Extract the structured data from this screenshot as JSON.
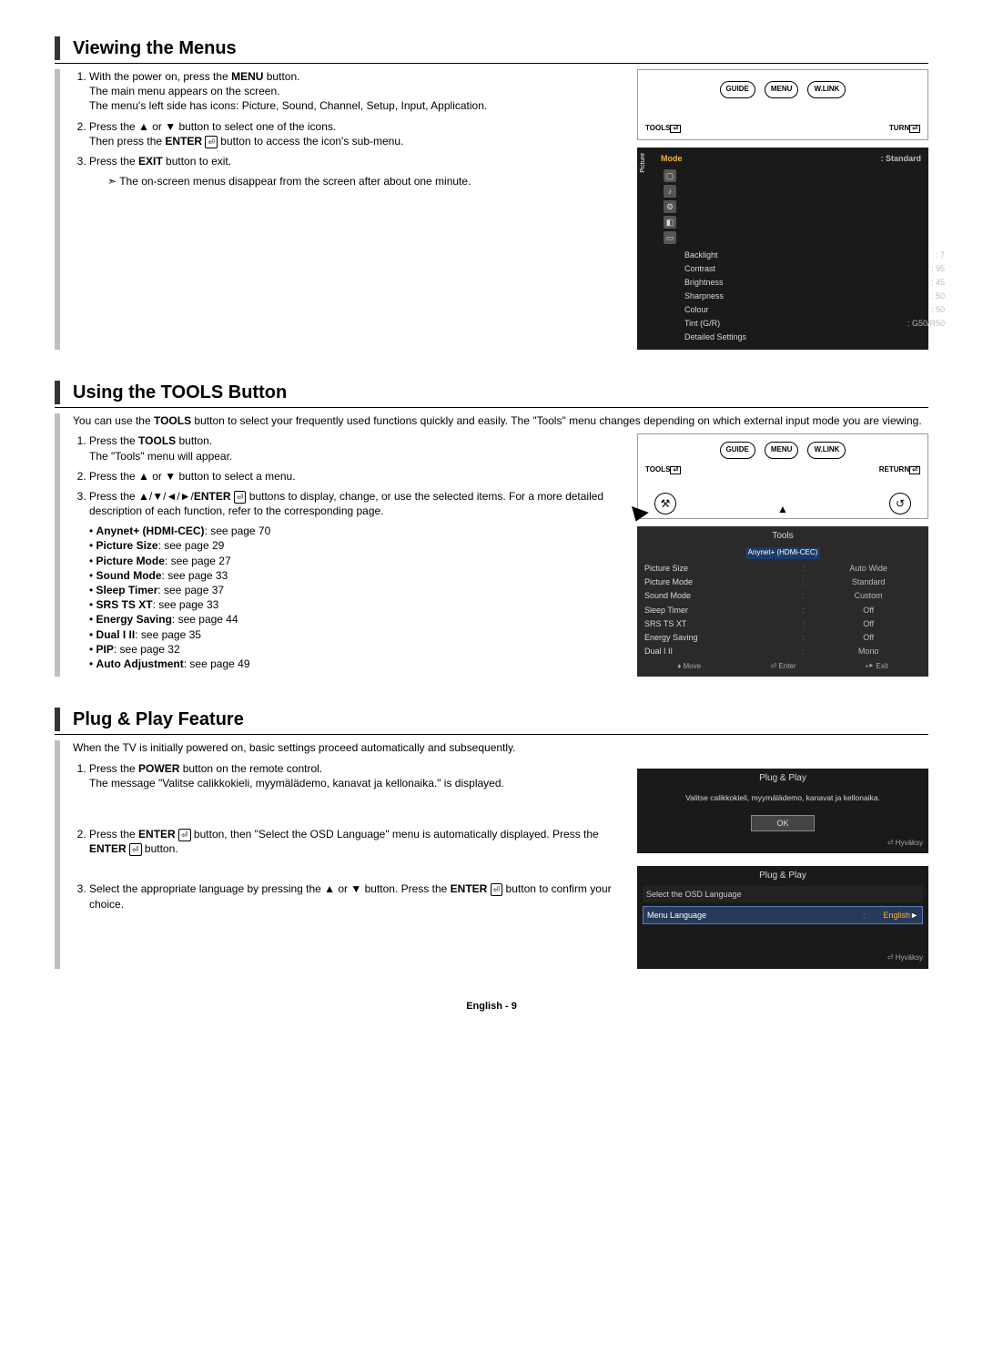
{
  "sections": {
    "viewing": {
      "title": "Viewing the Menus",
      "step1a": "With the power on, press the ",
      "step1b": "MENU",
      "step1c": " button.",
      "step1d": "The main menu appears on the screen.",
      "step1e": "The menu's left side has icons: Picture, Sound, Channel, Setup, Input, Application.",
      "step2a": "Press the ▲ or ▼ button to select one of the icons.",
      "step2b": "Then press the ",
      "step2c": "ENTER",
      "step2d": " button to access the icon's sub-menu.",
      "step3a": "Press the ",
      "step3b": "EXIT",
      "step3c": " button to exit.",
      "note": "The on-screen menus disappear from the screen after about one minute."
    },
    "tools": {
      "title": "Using the TOOLS Button",
      "intro1": "You can use the ",
      "intro2": "TOOLS",
      "intro3": " button to select your frequently used functions quickly and easily. The \"Tools\" menu changes depending on which external input mode you are viewing.",
      "step1a": "Press the ",
      "step1b": "TOOLS",
      "step1c": " button.",
      "step1d": "The \"Tools\" menu will appear.",
      "step2": "Press the ▲ or ▼ button to select a menu.",
      "step3a": "Press the ▲/▼/◄/►/",
      "step3b": "ENTER",
      "step3c": " buttons to display, change, or use the selected items. For a more detailed description of each function, refer to the corresponding page.",
      "list": [
        {
          "b": "Anynet+ (HDMI-CEC)",
          "t": ": see page 70"
        },
        {
          "b": "Picture Size",
          "t": ": see page 29"
        },
        {
          "b": "Picture Mode",
          "t": ": see page 27"
        },
        {
          "b": "Sound Mode",
          "t": ": see page 33"
        },
        {
          "b": "Sleep Timer",
          "t": ": see page 37"
        },
        {
          "b": "SRS TS XT",
          "t": ": see page 33"
        },
        {
          "b": "Energy Saving",
          "t": ": see page 44"
        },
        {
          "b": "Dual I II",
          "t": ": see page 35"
        },
        {
          "b": "PIP",
          "t": ": see page 32"
        },
        {
          "b": "Auto Adjustment",
          "t": ": see page 49"
        }
      ]
    },
    "plug": {
      "title": "Plug & Play Feature",
      "intro": "When the TV is initially powered on, basic settings proceed automatically and subsequently.",
      "step1a": "Press the ",
      "step1b": "POWER",
      "step1c": " button on the remote control.",
      "step1d": "The message \"Valitse calikkokieli, myymälädemo, kanavat ja kellonaika.\" is displayed.",
      "step2a": "Press the ",
      "step2b": "ENTER",
      "step2c": " button, then \"Select the OSD Language\" menu is automatically displayed. Press the ",
      "step2d": "ENTER",
      "step2e": " button.",
      "step3a": "Select the appropriate language by pressing the ▲ or ▼ button. Press the ",
      "step3b": "ENTER",
      "step3c": " button to confirm your choice."
    }
  },
  "remote": {
    "guide": "GUIDE",
    "menu": "MENU",
    "wlink": "W.LINK",
    "tools": "TOOLS",
    "return": "RETURN",
    "turn": "TURN"
  },
  "osd_picture": {
    "tab": "Picture",
    "mode_label": "Mode",
    "mode_value": "Standard",
    "rows": [
      {
        "k": "Backlight",
        "v": ": 7"
      },
      {
        "k": "Contrast",
        "v": ": 95"
      },
      {
        "k": "Brightness",
        "v": ": 45"
      },
      {
        "k": "Sharpness",
        "v": ": 50"
      },
      {
        "k": "Colour",
        "v": ": 50"
      },
      {
        "k": "Tint (G/R)",
        "v": ": G50/R50"
      },
      {
        "k": "Detailed Settings",
        "v": ""
      }
    ]
  },
  "osd_tools": {
    "title": "Tools",
    "hi": "Anynet+ (HDMi-CEC)",
    "rows": [
      {
        "k": "Picture Size",
        "v": "Auto Wide"
      },
      {
        "k": "Picture Mode",
        "v": "Standard"
      },
      {
        "k": "Sound Mode",
        "v": "Custom"
      },
      {
        "k": "Sleep Timer",
        "v": "Off"
      },
      {
        "k": "SRS TS XT",
        "v": "Off"
      },
      {
        "k": "Energy Saving",
        "v": "Off"
      },
      {
        "k": "Dual I II",
        "v": "Mono"
      }
    ],
    "footer": {
      "move": "♦ Move",
      "enter": "⏎ Enter",
      "exit": "▪⯈ Exit"
    }
  },
  "osd_plug1": {
    "title": "Plug & Play",
    "msg": "Valitse calikkokieli, myymälädemo, kanavat ja kellonaika.",
    "ok": "OK",
    "hyv": "⏎ Hyväksy"
  },
  "osd_plug2": {
    "title": "Plug & Play",
    "head": "Select the OSD Language",
    "k": "Menu Language",
    "v": "English",
    "hyv": "⏎ Hyväksy"
  },
  "enter_glyph": "⏎",
  "note_arrow": "➣",
  "footer": "English - 9"
}
